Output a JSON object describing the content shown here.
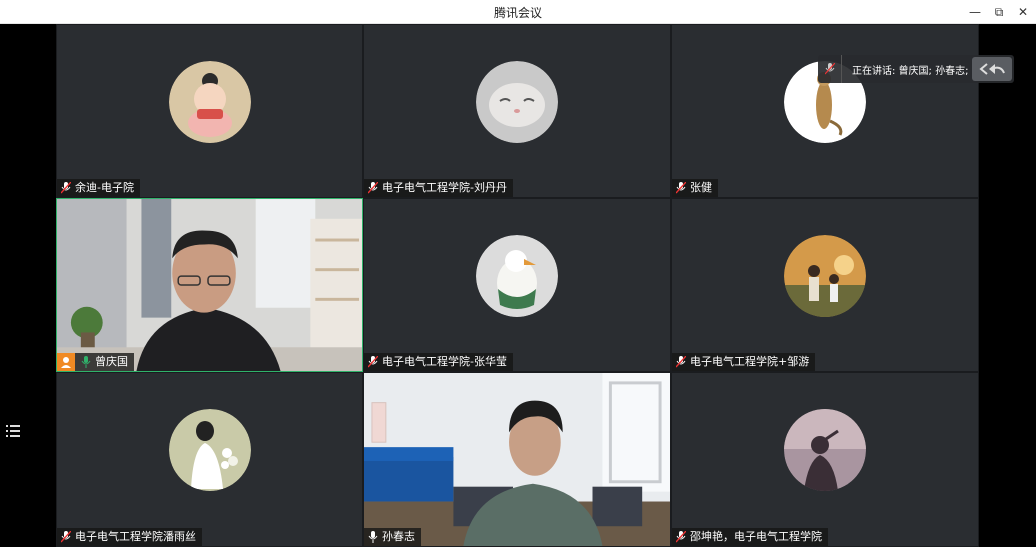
{
  "window": {
    "title": "腾讯会议",
    "minimize": "—",
    "restore": "⧉",
    "close": "✕"
  },
  "speaking": {
    "text": "正在讲话: 曾庆国; 孙春志;"
  },
  "participants": [
    {
      "name": "余迪-电子院"
    },
    {
      "name": "电子电气工程学院-刘丹丹"
    },
    {
      "name": "张健"
    },
    {
      "name": "曾庆国"
    },
    {
      "name": "电子电气工程学院-张华莹"
    },
    {
      "name": "电子电气工程学院+邹游"
    },
    {
      "name": "电子电气工程学院潘雨丝"
    },
    {
      "name": "孙春志"
    },
    {
      "name": "邵坤艳，电子电气工程学院"
    }
  ],
  "colors": {
    "accent_green": "#2fb26a",
    "host_orange": "#f08a24",
    "tile_bg": "#2a2d31"
  }
}
